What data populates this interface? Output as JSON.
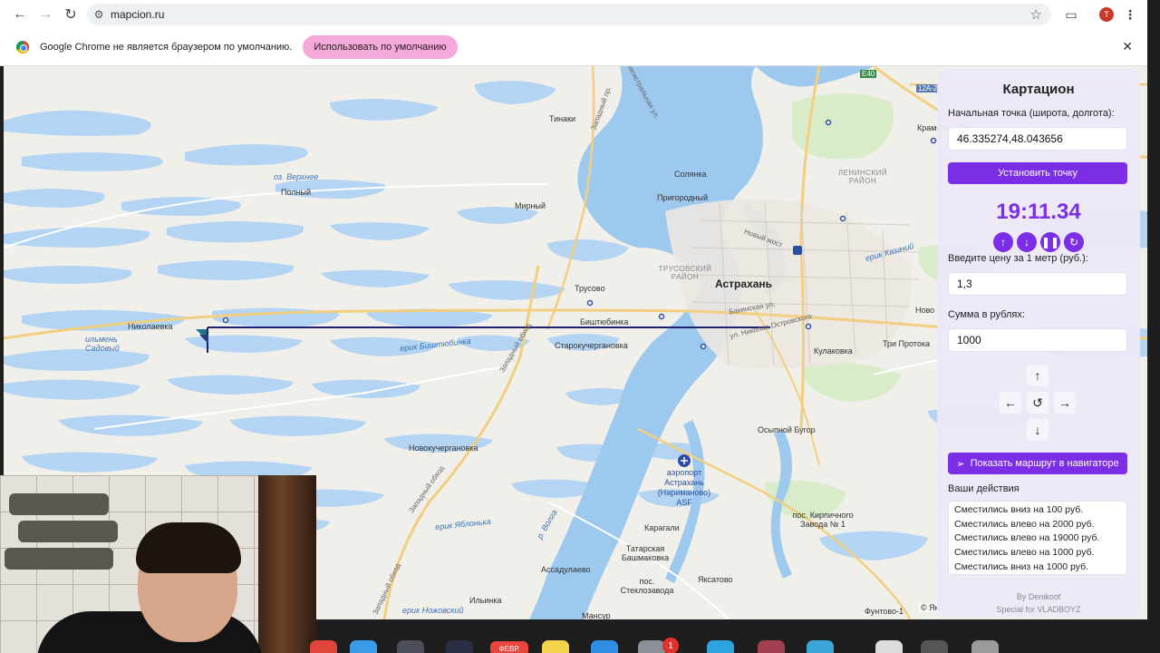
{
  "browser": {
    "url": "mapcion.ru",
    "profile_initial": "T",
    "icons": {
      "back": "back-arrow-icon",
      "forward": "forward-arrow-icon",
      "reload": "reload-icon",
      "site_info": "site-info-icon",
      "bookmark": "star-icon",
      "extensions": "puzzle-icon",
      "menu": "kebab-menu-icon"
    }
  },
  "infobar": {
    "message": "Google Chrome не является браузером по умолчанию.",
    "button_label": "Использовать по умолчанию",
    "close_icon": "close-icon"
  },
  "map": {
    "labels": {
      "tinaki": "Тинаки",
      "oz_verkhnee": "оз. Верхнее",
      "polnyi": "Полный",
      "solyanka": "Солянка",
      "prigorodny": "Пригородный",
      "mirny": "Мирный",
      "leninsky": "ЛЕНИНСКИЙ РАЙОН",
      "astrakhan": "Астрахань",
      "trusovsky": "ТРУСОВСКИЙ РАЙОН",
      "trusovo": "Трусово",
      "bishtyubinka": "Биштюбинка",
      "starokucherganovka": "Старокучергановка",
      "nikolaevka": "Николаевка",
      "ilmen_sadovy": "ильмень Садовый",
      "erik_bishtyubinka": "ерик Биштюбинка",
      "kulakovka": "Кулаковка",
      "tri_protoka": "Три Протока",
      "novokucherganovka": "Новокучергановка",
      "osypnoy_bugor": "Осыпной Бугор",
      "airport": "аэропорт Астрахань (Нариманово) ASF",
      "karagali": "Карагали",
      "kirpichnogo": "пос. Кирпичного Завода № 1",
      "tatarskaya": "Татарская Башмаковка",
      "assadulaevo": "Ассадулаево",
      "yaksatovo": "Яксатово",
      "steklozavoda": "пос. Стеклозавода",
      "ilyinka": "Ильинка",
      "mansur": "Мансур",
      "funtovo": "Фунтово-1",
      "novy_most": "Новый мост",
      "erik_yablonka": "ерик Яблонька",
      "erik_nozhovsky": "ерик Ножовский",
      "e40": "E40",
      "r12a": "12А-2",
      "kramat": "Крамато",
      "novo": "Ново",
      "erik_kazachiy": "ерик Казачий",
      "r_volga": "р. Волга",
      "zapadny_obhod": "Западный обход",
      "zapadny_obhod2": "Западный обход",
      "zapadny_obhod3": "Западный обход",
      "ostrovskogo": "ул. Николая Островского",
      "bakinskaya": "Бакинская ул.",
      "magistralnaya": "Магистральная ул.",
      "zapadny_proezd": "Западный пр."
    },
    "copyright": "© Ян"
  },
  "panel": {
    "title": "Картацион",
    "start_label": "Начальная точка (широта, долгота):",
    "start_value": "46.335274,48.043656",
    "set_point_button": "Установить точку",
    "timer": "19:11.34",
    "timer_controls": [
      "arrow-up-icon",
      "arrow-down-icon",
      "pause-icon",
      "refresh-icon"
    ],
    "price_label": "Введите цену за 1 метр (руб.):",
    "price_value": "1,3",
    "sum_label": "Сумма в рублях:",
    "sum_value": "1000",
    "direction_icons": [
      "arrow-up-icon",
      "arrow-left-icon",
      "reset-icon",
      "arrow-right-icon",
      "arrow-down-icon"
    ],
    "route_button": "Показать маршрут в навигаторе",
    "route_icon": "route-icon",
    "actions_label": "Ваши действия",
    "actions": [
      "Сместились вниз на 100 руб.",
      "Сместились влево на 2000 руб.",
      "Сместились влево на 19000 руб.",
      "Сместились влево на 1000 руб.",
      "Сместились вниз на 1000 руб."
    ],
    "credit_by": "By Denikoof",
    "credit_special": "Special for VLADBOYZ"
  },
  "dock": {
    "date_badge": "ФЕВР.",
    "notification_count": "1"
  }
}
